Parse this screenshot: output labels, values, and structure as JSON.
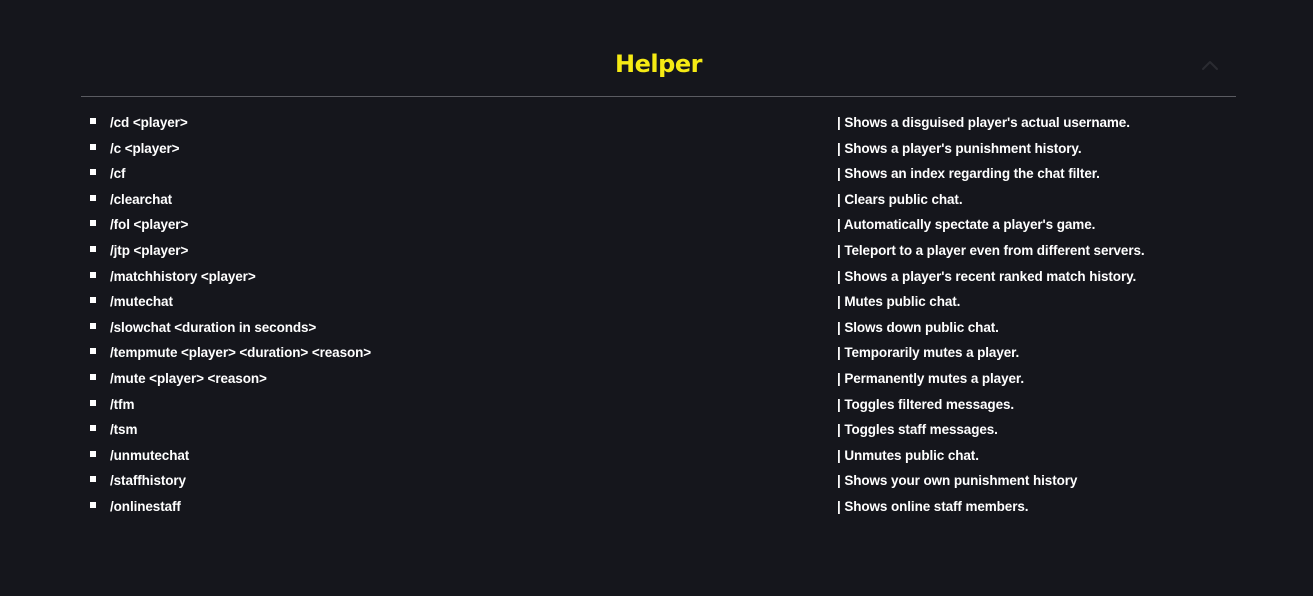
{
  "section": {
    "title": "Helper",
    "toggle_icon": "chevron-up-icon",
    "colors": {
      "title": "#f5ea14",
      "background": "#15161c",
      "text": "#ffffff",
      "divider": "#5a5b61"
    }
  },
  "commands": [
    {
      "command": "/cd <player>",
      "description": "| Shows a disguised player's actual username."
    },
    {
      "command": "/c <player>",
      "description": "| Shows a player's punishment history."
    },
    {
      "command": "/cf",
      "description": "| Shows an index regarding the chat filter."
    },
    {
      "command": "/clearchat",
      "description": "| Clears public chat."
    },
    {
      "command": "/fol <player>",
      "description": "| Automatically spectate a player's game."
    },
    {
      "command": "/jtp <player>",
      "description": "| Teleport to a player even from different servers."
    },
    {
      "command": "/matchhistory <player>",
      "description": "| Shows a player's recent ranked match history."
    },
    {
      "command": "/mutechat",
      "description": "| Mutes public chat."
    },
    {
      "command": "/slowchat <duration in seconds>",
      "description": "| Slows down public chat."
    },
    {
      "command": "/tempmute <player> <duration> <reason>",
      "description": "| Temporarily mutes a player."
    },
    {
      "command": "/mute <player> <reason>",
      "description": "| Permanently mutes a player."
    },
    {
      "command": "/tfm",
      "description": "| Toggles filtered messages."
    },
    {
      "command": "/tsm",
      "description": "| Toggles staff messages."
    },
    {
      "command": "/unmutechat",
      "description": "| Unmutes public chat."
    },
    {
      "command": "/staffhistory",
      "description": "| Shows your own punishment history"
    },
    {
      "command": "/onlinestaff",
      "description": "| Shows online staff members."
    }
  ]
}
